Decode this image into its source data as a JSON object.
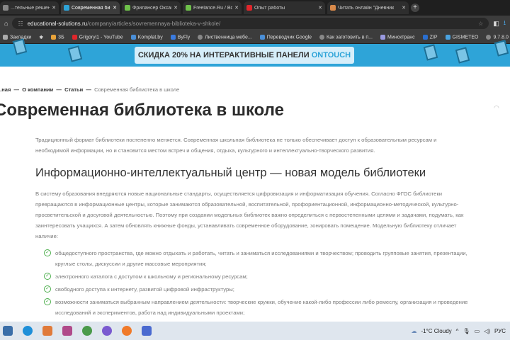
{
  "tabs": [
    {
      "title": "...тельные решен",
      "color": "#888"
    },
    {
      "title": "Современная библиотек",
      "color": "#2ea4d8",
      "active": true
    },
    {
      "title": "Фрилансер Оксана Лисиц",
      "color": "#6ec04a"
    },
    {
      "title": "Freelance.Ru / Восстановл",
      "color": "#6ec04a"
    },
    {
      "title": "Опыт работы",
      "color": "#e0262b"
    },
    {
      "title": "Читать онлайн \"Дневник",
      "color": "#d8894a"
    }
  ],
  "address": {
    "domain": "educational-solutions.ru",
    "path": "/company/articles/sovremennaya-biblioteka-v-shkole/"
  },
  "bookmarks": [
    "Закладки",
    "",
    "3Б",
    "Grigoryi1 - YouTube",
    "Komplat.by",
    "ByFly",
    "Лиственница мебе...",
    "Переводчик Google",
    "Как заготовить в п...",
    "Минсктранс",
    "ZIP",
    "GISMETEO",
    "9.7.8.0"
  ],
  "banner": {
    "text": "СКИДКА 20% НА ИНТЕРАКТИВНЫЕ ПАНЕЛИ",
    "accent": "ONTOUCH"
  },
  "breadcrumb": [
    "...ная",
    "О компании",
    "Статьи",
    "Современная библиотека в школе"
  ],
  "title": "Современная библиотека в школе",
  "intro": "Традиционный формат библиотеки постепенно меняется. Современная школьная библиотека не только обеспечивает доступ к образовательным ресурсам и необходимой информации, но и становится местом встреч и общения, отдыха, культурного и интеллектуально-творческого развития.",
  "h2": "Информационно-интеллектуальный центр — новая модель библиотеки",
  "para": "В систему образования внедряются новые национальные стандарты, осуществляется цифровизация и информатизация обучения. Согласно ФГОС библиотеки превращаются в информационные центры, которые занимаются образовательной, воспитательной, профориентационной, информационно-методической, культурно-просветительской и досуговой деятельностью. Поэтому при создании модельных библиотек важно определиться с первостепенными целями и задачами, подумать, как заинтересовать учащихся. А затем обновлять книжные фонды, устанавливать современное оборудование, зонировать помещение. Модельную библиотеку отличает наличие:",
  "list": [
    "общедоступного пространства, где можно отдыхать и работать, читать и заниматься исследованиями и творчеством; проводить групповые занятия, презентации, круглые столы, дискуссии и другие массовые мероприятия;",
    "электронного каталога с доступом к школьному и региональному ресурсам;",
    "свободного доступа к интернету, развитой цифровой инфраструктуры;",
    "возможности заниматься выбранным направлением деятельности: творческие кружки, обучение какой-либо профессии либо ремеслу, организация и проведение исследований и экспериментов, работа над индивидуальными проектами;"
  ],
  "tray": {
    "weather": "-1°C Cloudy",
    "lang": "РУС"
  }
}
